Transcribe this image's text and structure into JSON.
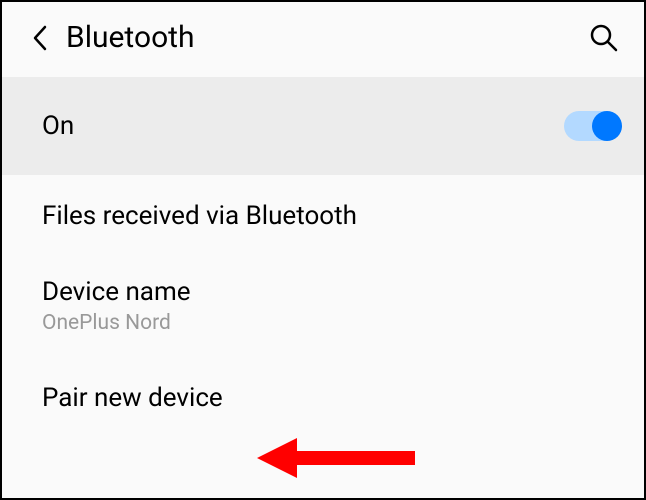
{
  "header": {
    "title": "Bluetooth"
  },
  "toggle": {
    "label": "On",
    "state": true
  },
  "files_received": {
    "label": "Files received via Bluetooth"
  },
  "device_name": {
    "label": "Device name",
    "value": "OnePlus Nord"
  },
  "pair_new": {
    "label": "Pair new device"
  }
}
